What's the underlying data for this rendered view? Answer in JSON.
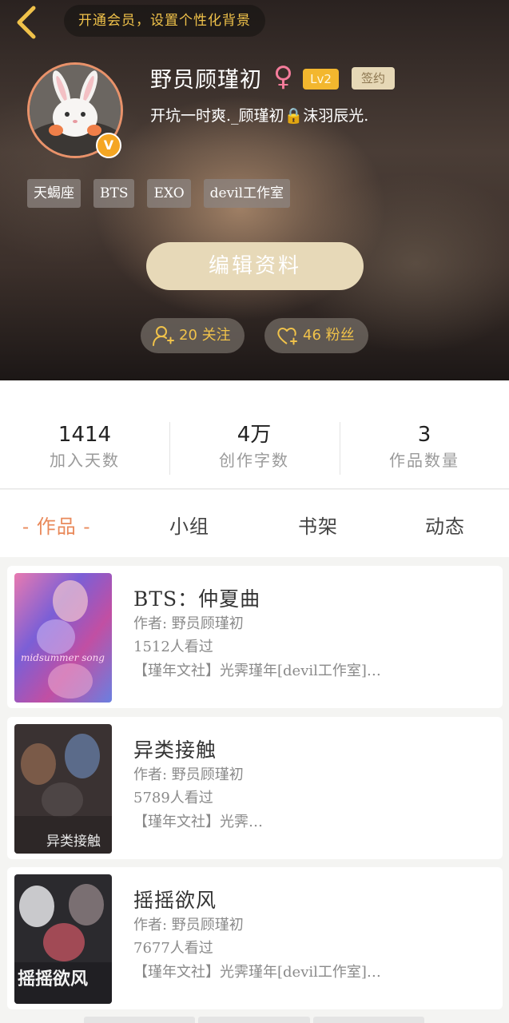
{
  "header": {
    "vip_banner": "开通会员，设置个性化背景",
    "username": "野员顾瑾初",
    "gender_symbol": "♀",
    "level": "Lv2",
    "signed_badge": "签约",
    "signature": "开坑一时爽._顾瑾初🔒沫羽辰光.",
    "avatar_badge": "V",
    "tags": [
      "天蝎座",
      "BTS",
      "EXO",
      "devil工作室"
    ],
    "edit_button": "编辑资料",
    "following": "20 关注",
    "fans": "46 粉丝"
  },
  "stats": [
    {
      "value": "1414",
      "label": "加入天数"
    },
    {
      "value": "4万",
      "label": "创作字数"
    },
    {
      "value": "3",
      "label": "作品数量"
    }
  ],
  "tabs": [
    {
      "label": "- 作品 -",
      "active": true
    },
    {
      "label": "小组",
      "active": false
    },
    {
      "label": "书架",
      "active": false
    },
    {
      "label": "动态",
      "active": false
    }
  ],
  "works": [
    {
      "title": "BTS：仲夏曲",
      "author": "作者: 野员顾瑾初",
      "views": "1512人看过",
      "tags": "【瑾年文社】光霁瑾年[devil工作室]…",
      "cover_text": "midsummer song"
    },
    {
      "title": "异类接触",
      "author": "作者: 野员顾瑾初",
      "views": "5789人看过",
      "tags": "【瑾年文社】光霁…",
      "cover_text": "异类接触"
    },
    {
      "title": "摇摇欲风",
      "author": "作者: 野员顾瑾初",
      "views": "7677人看过",
      "tags": "【瑾年文社】光霁瑾年[devil工作室]…",
      "cover_text": "摇摇欲风"
    }
  ],
  "colors": {
    "accent": "#e9895a",
    "gold": "#f0c24a",
    "edit_button_bg": "#e7d9b8"
  },
  "icons": {
    "back": "chevron-left-icon",
    "follow": "user-plus-icon",
    "fans": "heart-plus-icon"
  }
}
